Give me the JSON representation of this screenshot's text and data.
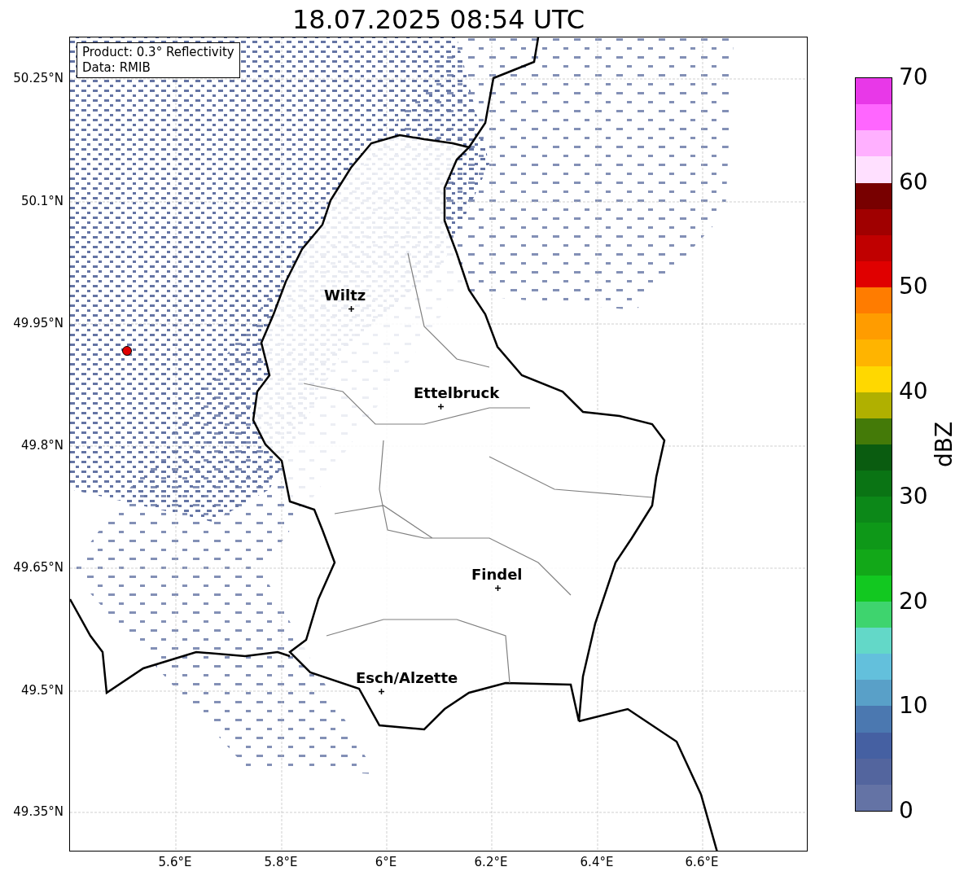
{
  "title": "18.07.2025 08:54 UTC",
  "legend": {
    "product": "Product: 0.3° Reflectivity",
    "data": "Data: RMIB"
  },
  "map": {
    "lat_ticks": [
      "50.25°N",
      "50.1°N",
      "49.95°N",
      "49.8°N",
      "49.65°N",
      "49.5°N",
      "49.35°N"
    ],
    "lon_ticks": [
      "5.6°E",
      "5.8°E",
      "6°E",
      "6.2°E",
      "6.4°E",
      "6.6°E"
    ],
    "cities": [
      {
        "name": "Wiltz"
      },
      {
        "name": "Ettelbruck"
      },
      {
        "name": "Findel"
      },
      {
        "name": "Esch/Alzette"
      }
    ]
  },
  "colorbar": {
    "label": "dBZ",
    "ticks": [
      "70",
      "60",
      "50",
      "40",
      "30",
      "20",
      "10",
      "0"
    ],
    "segments": [
      {
        "color": "#e838e8"
      },
      {
        "color": "#ff66ff"
      },
      {
        "color": "#ffb0ff"
      },
      {
        "color": "#ffe0ff"
      },
      {
        "color": "#780000"
      },
      {
        "color": "#a00000"
      },
      {
        "color": "#c00000"
      },
      {
        "color": "#e00000"
      },
      {
        "color": "#ff7c00"
      },
      {
        "color": "#ff9c00"
      },
      {
        "color": "#ffb400"
      },
      {
        "color": "#ffd800"
      },
      {
        "color": "#b0b000"
      },
      {
        "color": "#447a08"
      },
      {
        "color": "#0a5c10"
      },
      {
        "color": "#0a7414"
      },
      {
        "color": "#0c8818"
      },
      {
        "color": "#0e9818"
      },
      {
        "color": "#12a818"
      },
      {
        "color": "#12c820"
      },
      {
        "color": "#3ed46e"
      },
      {
        "color": "#63d8c8"
      },
      {
        "color": "#63c0dc"
      },
      {
        "color": "#59a0c8"
      },
      {
        "color": "#4b78b0"
      },
      {
        "color": "#4560a2"
      },
      {
        "color": "#53659e"
      },
      {
        "color": "#6473a5"
      }
    ]
  }
}
